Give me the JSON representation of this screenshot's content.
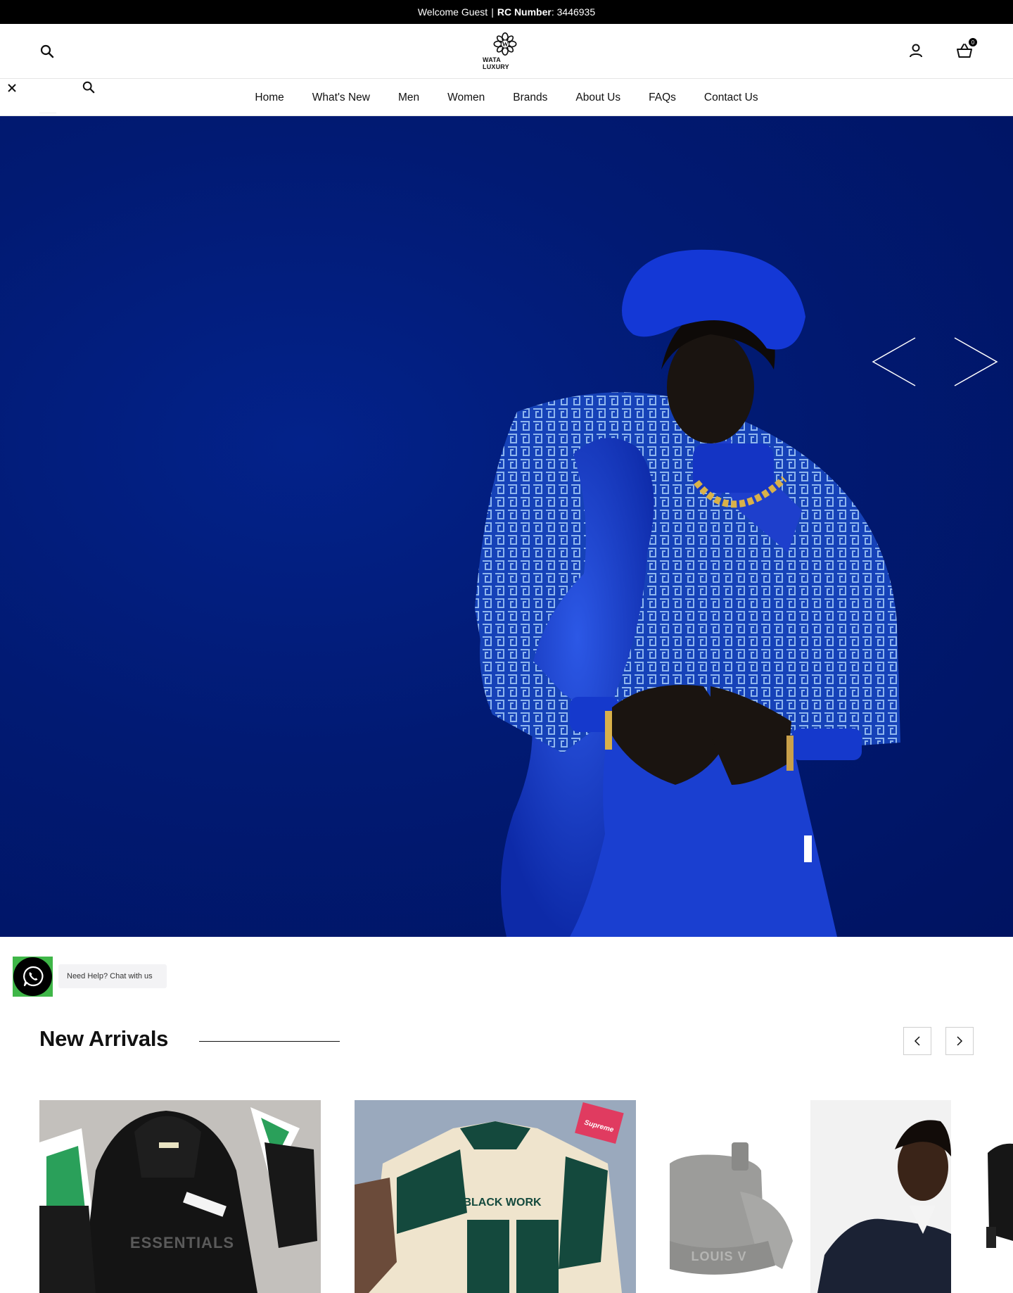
{
  "topbar": {
    "welcome": "Welcome Guest",
    "rc_label": "RC Number",
    "rc_value": ": 3446935"
  },
  "header": {
    "logo_text": "WATA LUXURY",
    "cart_count": "0",
    "icons": [
      "search-icon",
      "user-icon",
      "basket-icon",
      "close-icon"
    ]
  },
  "nav": {
    "items": [
      {
        "label": "Home"
      },
      {
        "label": "What's New"
      },
      {
        "label": "Men"
      },
      {
        "label": "Women"
      },
      {
        "label": "Brands"
      },
      {
        "label": "About Us"
      },
      {
        "label": "FAQs"
      },
      {
        "label": "Contact Us"
      }
    ]
  },
  "hero": {
    "background_color": "#011a73"
  },
  "help": {
    "label": "Need Help? Chat with us",
    "accent": "#3fb648"
  },
  "new_arrivals": {
    "title": "New Arrivals",
    "products": [
      {
        "image": "black essentials hoodie set",
        "text": "ESSENTIALS"
      },
      {
        "image": "green black work printed shirt",
        "text": "BLACK WORK",
        "badge": "Supreme"
      },
      {
        "image": "grey louis vuitton bags",
        "text": "LOUIS V"
      },
      {
        "image": "model in navy jacket"
      },
      {
        "image": "black bag partial"
      }
    ]
  }
}
